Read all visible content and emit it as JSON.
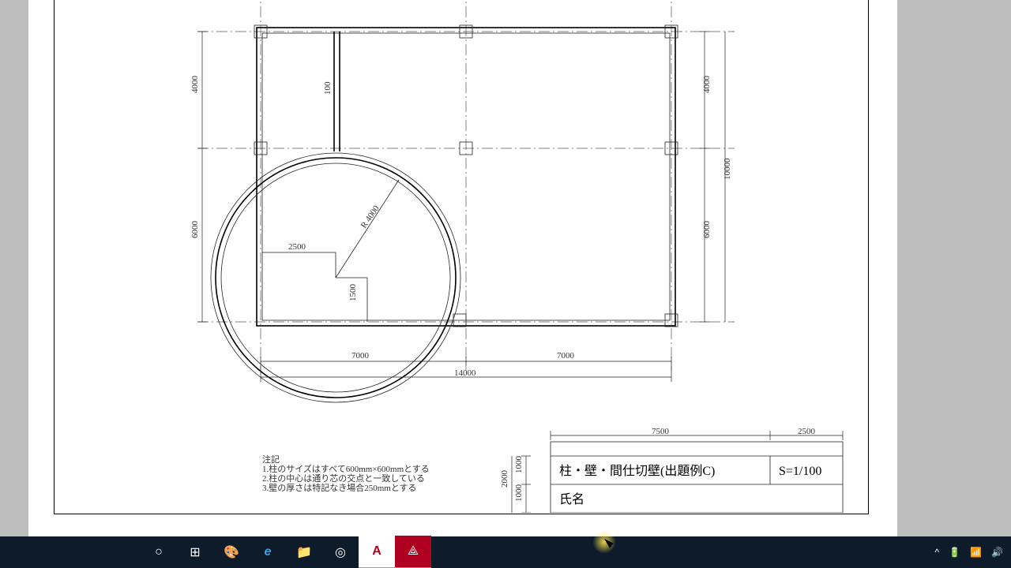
{
  "drawing": {
    "dims": {
      "top_left": "",
      "bottom_span_left": "7000",
      "bottom_span_right": "7000",
      "bottom_total": "14000",
      "left_upper": "4000",
      "left_lower": "6000",
      "right_upper": "4000",
      "right_lower": "6000",
      "right_total": "10000",
      "partition_h": "100",
      "inner_w": "2500",
      "inner_h": "1500",
      "radius": "R 4000"
    },
    "notes": {
      "heading": "注記",
      "line1": "1.柱のサイズはすべて600mm×600mmとする",
      "line2": "2.柱の中心は通り芯の交点と一致している",
      "line3": "3.壁の厚さは特記なき場合250mmとする"
    },
    "titleblock": {
      "top_dim_a": "7500",
      "top_dim_b": "2500",
      "left_dim_top": "1000",
      "left_dim_bottom": "1000",
      "left_dim_total": "2000",
      "title": "柱・壁・間仕切壁(出題例C)",
      "scale": "S=1/100",
      "name_label": "氏名"
    }
  },
  "taskbar": {
    "cortana": "○",
    "taskview": "⊞",
    "paint": "🎨",
    "edge": "e",
    "explorer": "📁",
    "chrome": "◎",
    "autocad": "A",
    "acrobat": "⟁"
  },
  "tray": {
    "up": "^",
    "battery": "🔋",
    "wifi": "📶",
    "volume": "🔊"
  }
}
